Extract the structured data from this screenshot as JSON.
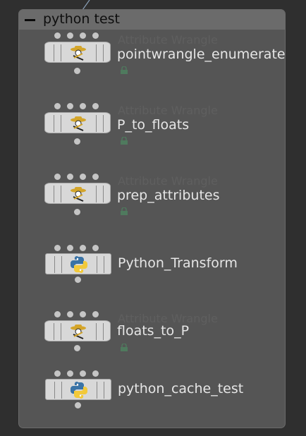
{
  "netbox": {
    "title": "python test",
    "collapse_icon": "minus-icon"
  },
  "nodes": [
    {
      "id": "pointwrangle_enumerate",
      "type_label": "Attribute Wrangle",
      "name": "pointwrangle_enumerate",
      "icon": "wrangle-cowboy-icon",
      "lock_icon": "lock-icon"
    },
    {
      "id": "P_to_floats",
      "type_label": "Attribute Wrangle",
      "name": "P_to_floats",
      "icon": "wrangle-cowboy-icon",
      "lock_icon": "lock-icon"
    },
    {
      "id": "prep_attributes",
      "type_label": "Attribute Wrangle",
      "name": "prep_attributes",
      "icon": "wrangle-cowboy-icon",
      "lock_icon": "lock-icon"
    },
    {
      "id": "Python_Transform",
      "type_label": "",
      "name": "Python_Transform",
      "icon": "python-logo-icon"
    },
    {
      "id": "floats_to_P",
      "type_label": "Attribute Wrangle",
      "name": "floats_to_P",
      "icon": "wrangle-cowboy-icon",
      "lock_icon": "lock-icon"
    },
    {
      "id": "python_cache_test",
      "type_label": "",
      "name": "python_cache_test",
      "icon": "python-logo-icon"
    }
  ],
  "colors": {
    "background": "#2f2f2f",
    "netbox_body": "#555555",
    "netbox_header": "#6b6b6b",
    "node_fill": "#d8d8d8",
    "wire": "#8aa0b8",
    "python_blue": "#3a73a6",
    "python_yellow": "#f2c93a",
    "cowboy_hat": "#d4a52a"
  }
}
